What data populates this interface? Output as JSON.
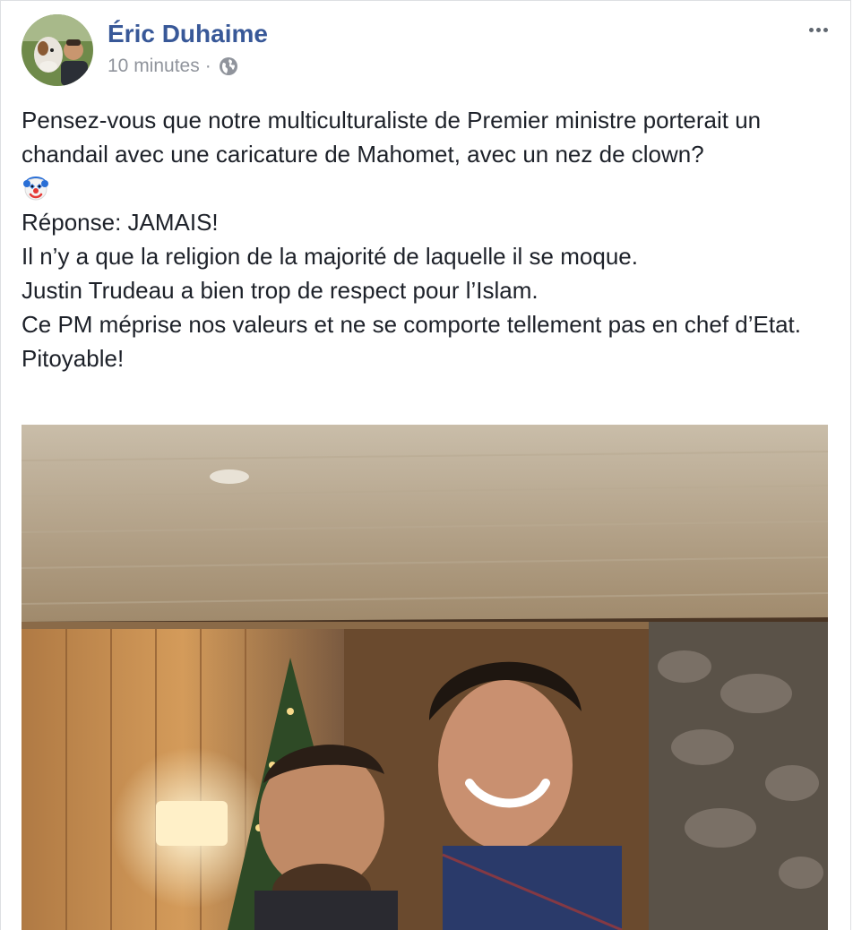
{
  "post": {
    "author": "Éric Duhaime",
    "timestamp": "10 minutes",
    "separator": "·",
    "privacy_icon": "globe-icon",
    "more_icon": "more-options-icon",
    "lines": {
      "l1": "Pensez-vous que notre multiculturaliste de Premier ministre porterait un chandail avec une caricature de Mahomet, avec un nez de clown?",
      "emoji": "clown-face-emoji",
      "l2": "Réponse: JAMAIS!",
      "l3": "Il n’y a que la religion de la majorité de laquelle il se moque.",
      "l4": "Justin Trudeau a bien trop de respect pour l’Islam.",
      "l5": "Ce PM méprise nos valeurs et ne se comporte tellement pas en chef d’Etat.",
      "l6": "Pitoyable!"
    }
  },
  "colors": {
    "author_link": "#385898",
    "meta_text": "#90949c",
    "body_text": "#1d2129"
  }
}
